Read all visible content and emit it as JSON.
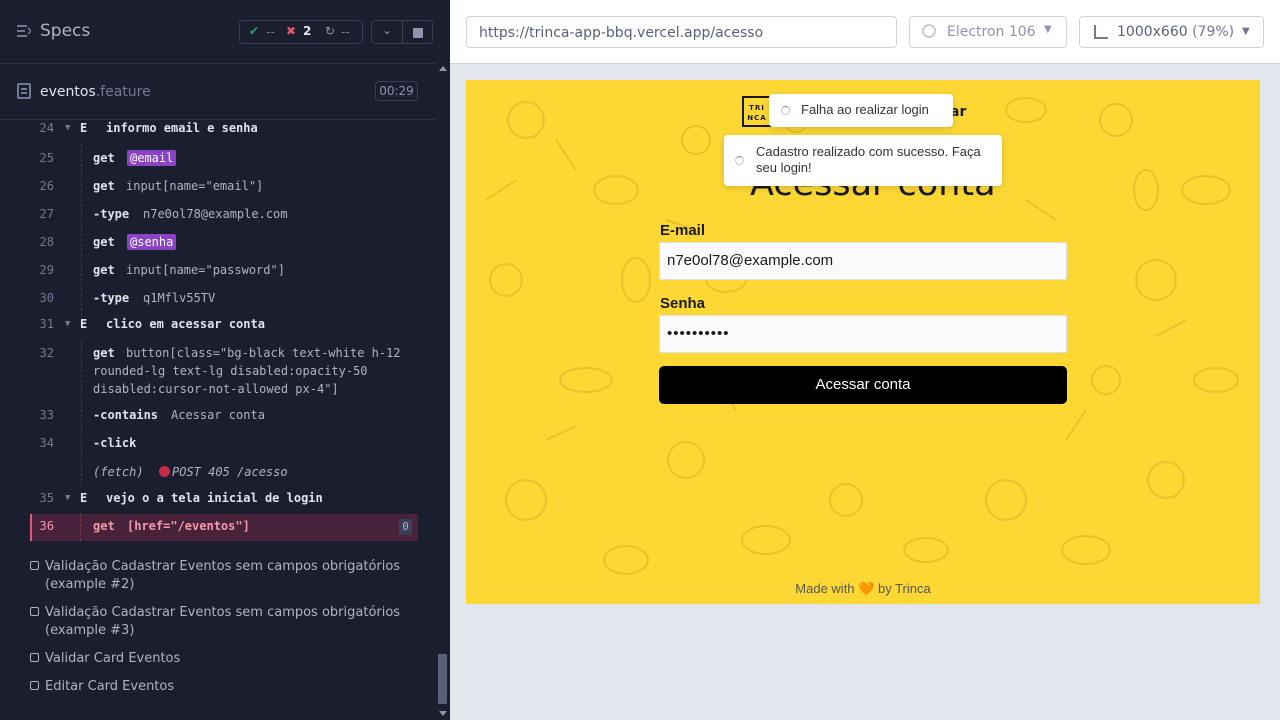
{
  "reporter": {
    "title": "Specs",
    "stats": {
      "passed": "--",
      "failed": "2",
      "pending": "--"
    },
    "file": {
      "name": "eventos",
      "ext": ".feature",
      "time": "00:29"
    },
    "steps": [
      {
        "line": "24",
        "keyword": "E",
        "text": "informo email e senha"
      },
      {
        "line": "31",
        "keyword": "E",
        "text": "clico em acessar conta"
      },
      {
        "line": "35",
        "keyword": "E",
        "text": "vejo o a tela inicial de login"
      }
    ],
    "commands": [
      {
        "line": "25",
        "name": "get",
        "alias": "@email"
      },
      {
        "line": "26",
        "name": "get",
        "message": "input[name=\"email\"]"
      },
      {
        "line": "27",
        "name": "-type",
        "message": "n7e0ol78@example.com"
      },
      {
        "line": "28",
        "name": "get",
        "alias": "@senha"
      },
      {
        "line": "29",
        "name": "get",
        "message": "input[name=\"password\"]"
      },
      {
        "line": "30",
        "name": "-type",
        "message": "q1Mflv55TV"
      },
      {
        "line": "32",
        "name": "get",
        "message_lines": [
          "button[class=\"bg-black text-white h-12",
          "rounded-lg text-lg disabled:opacity-50",
          "disabled:cursor-not-allowed px-4\"]"
        ]
      },
      {
        "line": "33",
        "name": "-contains",
        "message": "Acessar conta"
      },
      {
        "line": "34",
        "name": "-click"
      },
      {
        "name": "(fetch)",
        "message": "POST 405 /acesso"
      },
      {
        "line": "36",
        "name": "get",
        "message": "[href=\"/eventos\"]",
        "count": "0"
      }
    ],
    "tests": [
      "Validação Cadastrar Eventos sem campos obrigatórios (example #2)",
      "Validação Cadastrar Eventos sem campos obrigatórios (example #3)",
      "Validar Card Eventos",
      "Editar Card Eventos"
    ]
  },
  "aut": {
    "url": "https://trinca-app-bbq.vercel.app/acesso",
    "browser": "Electron 106",
    "viewport": "1000x660",
    "scale": "(79%)"
  },
  "app": {
    "logo_text": "TRI NCA",
    "brand_tail": "ar",
    "heading": "Acessar conta",
    "toasts": {
      "error": "Falha ao realizar login",
      "success": "Cadastro realizado com sucesso. Faça seu login!"
    },
    "email_label": "E-mail",
    "email_value": "n7e0ol78@example.com",
    "password_label": "Senha",
    "password_value": "••••••••••",
    "submit_label": "Acessar conta",
    "footer_prefix": "Made with",
    "footer_heart": "🧡",
    "footer_suffix": "by Trinca"
  },
  "colors": {
    "reporter_bg": "#1b1e2e",
    "app_bg": "#fdd835",
    "alias_bg": "#8b44c5",
    "failed": "#e45770",
    "passed": "#1fa971"
  }
}
